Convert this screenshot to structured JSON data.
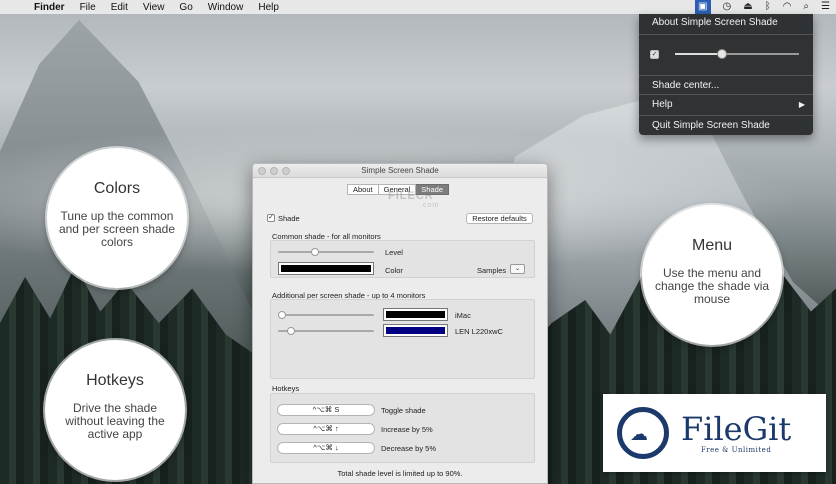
{
  "menubar": {
    "items": [
      "Finder",
      "File",
      "Edit",
      "View",
      "Go",
      "Window",
      "Help"
    ],
    "status_icons": [
      "shade-icon",
      "clock-icon",
      "eject-icon",
      "bluetooth-icon",
      "wifi-icon",
      "search-icon",
      "list-icon"
    ]
  },
  "dropdown": {
    "about": "About Simple Screen Shade",
    "shade_enabled": true,
    "shade_level": 0.38,
    "shade_center": "Shade center...",
    "help": "Help",
    "quit": "Quit Simple Screen Shade"
  },
  "bubbles": {
    "colors": {
      "title": "Colors",
      "text": "Tune up the common and per screen shade colors"
    },
    "hotkeys": {
      "title": "Hotkeys",
      "text": "Drive the shade without leaving the active app"
    },
    "menu": {
      "title": "Menu",
      "text": "Use the menu and change the shade via mouse"
    }
  },
  "window": {
    "title": "Simple Screen Shade",
    "watermark": "FILECR",
    "watermark_sub": ".com",
    "tabs": [
      {
        "label": "About",
        "selected": false
      },
      {
        "label": "General",
        "selected": false
      },
      {
        "label": "Shade",
        "selected": true
      }
    ],
    "shade_checkbox_label": "Shade",
    "shade_checked": true,
    "restore_button": "Restore defaults",
    "common": {
      "title": "Common shade - for all monitors",
      "level_label": "Level",
      "level_value": 0.38,
      "color_label": "Color",
      "color": "#000000",
      "samples_label": "Samples"
    },
    "per_screen": {
      "title": "Additional per screen shade - up to 4 monitors",
      "monitors": [
        {
          "name": "iMac",
          "level": 0.0,
          "color": "#000000"
        },
        {
          "name": "LEN L220xwC",
          "level": 0.1,
          "color": "#000080"
        }
      ]
    },
    "hotkeys": {
      "title": "Hotkeys",
      "items": [
        {
          "keys": "^⌥⌘ S",
          "action": "Toggle shade"
        },
        {
          "keys": "^⌥⌘ ↑",
          "action": "Increase by 5%"
        },
        {
          "keys": "^⌥⌘ ↓",
          "action": "Decrease by 5%"
        }
      ]
    },
    "footer": "Total shade level is limited up to 90%."
  },
  "badge": {
    "name": "FileGit",
    "tagline": "Free & Unlimited"
  }
}
